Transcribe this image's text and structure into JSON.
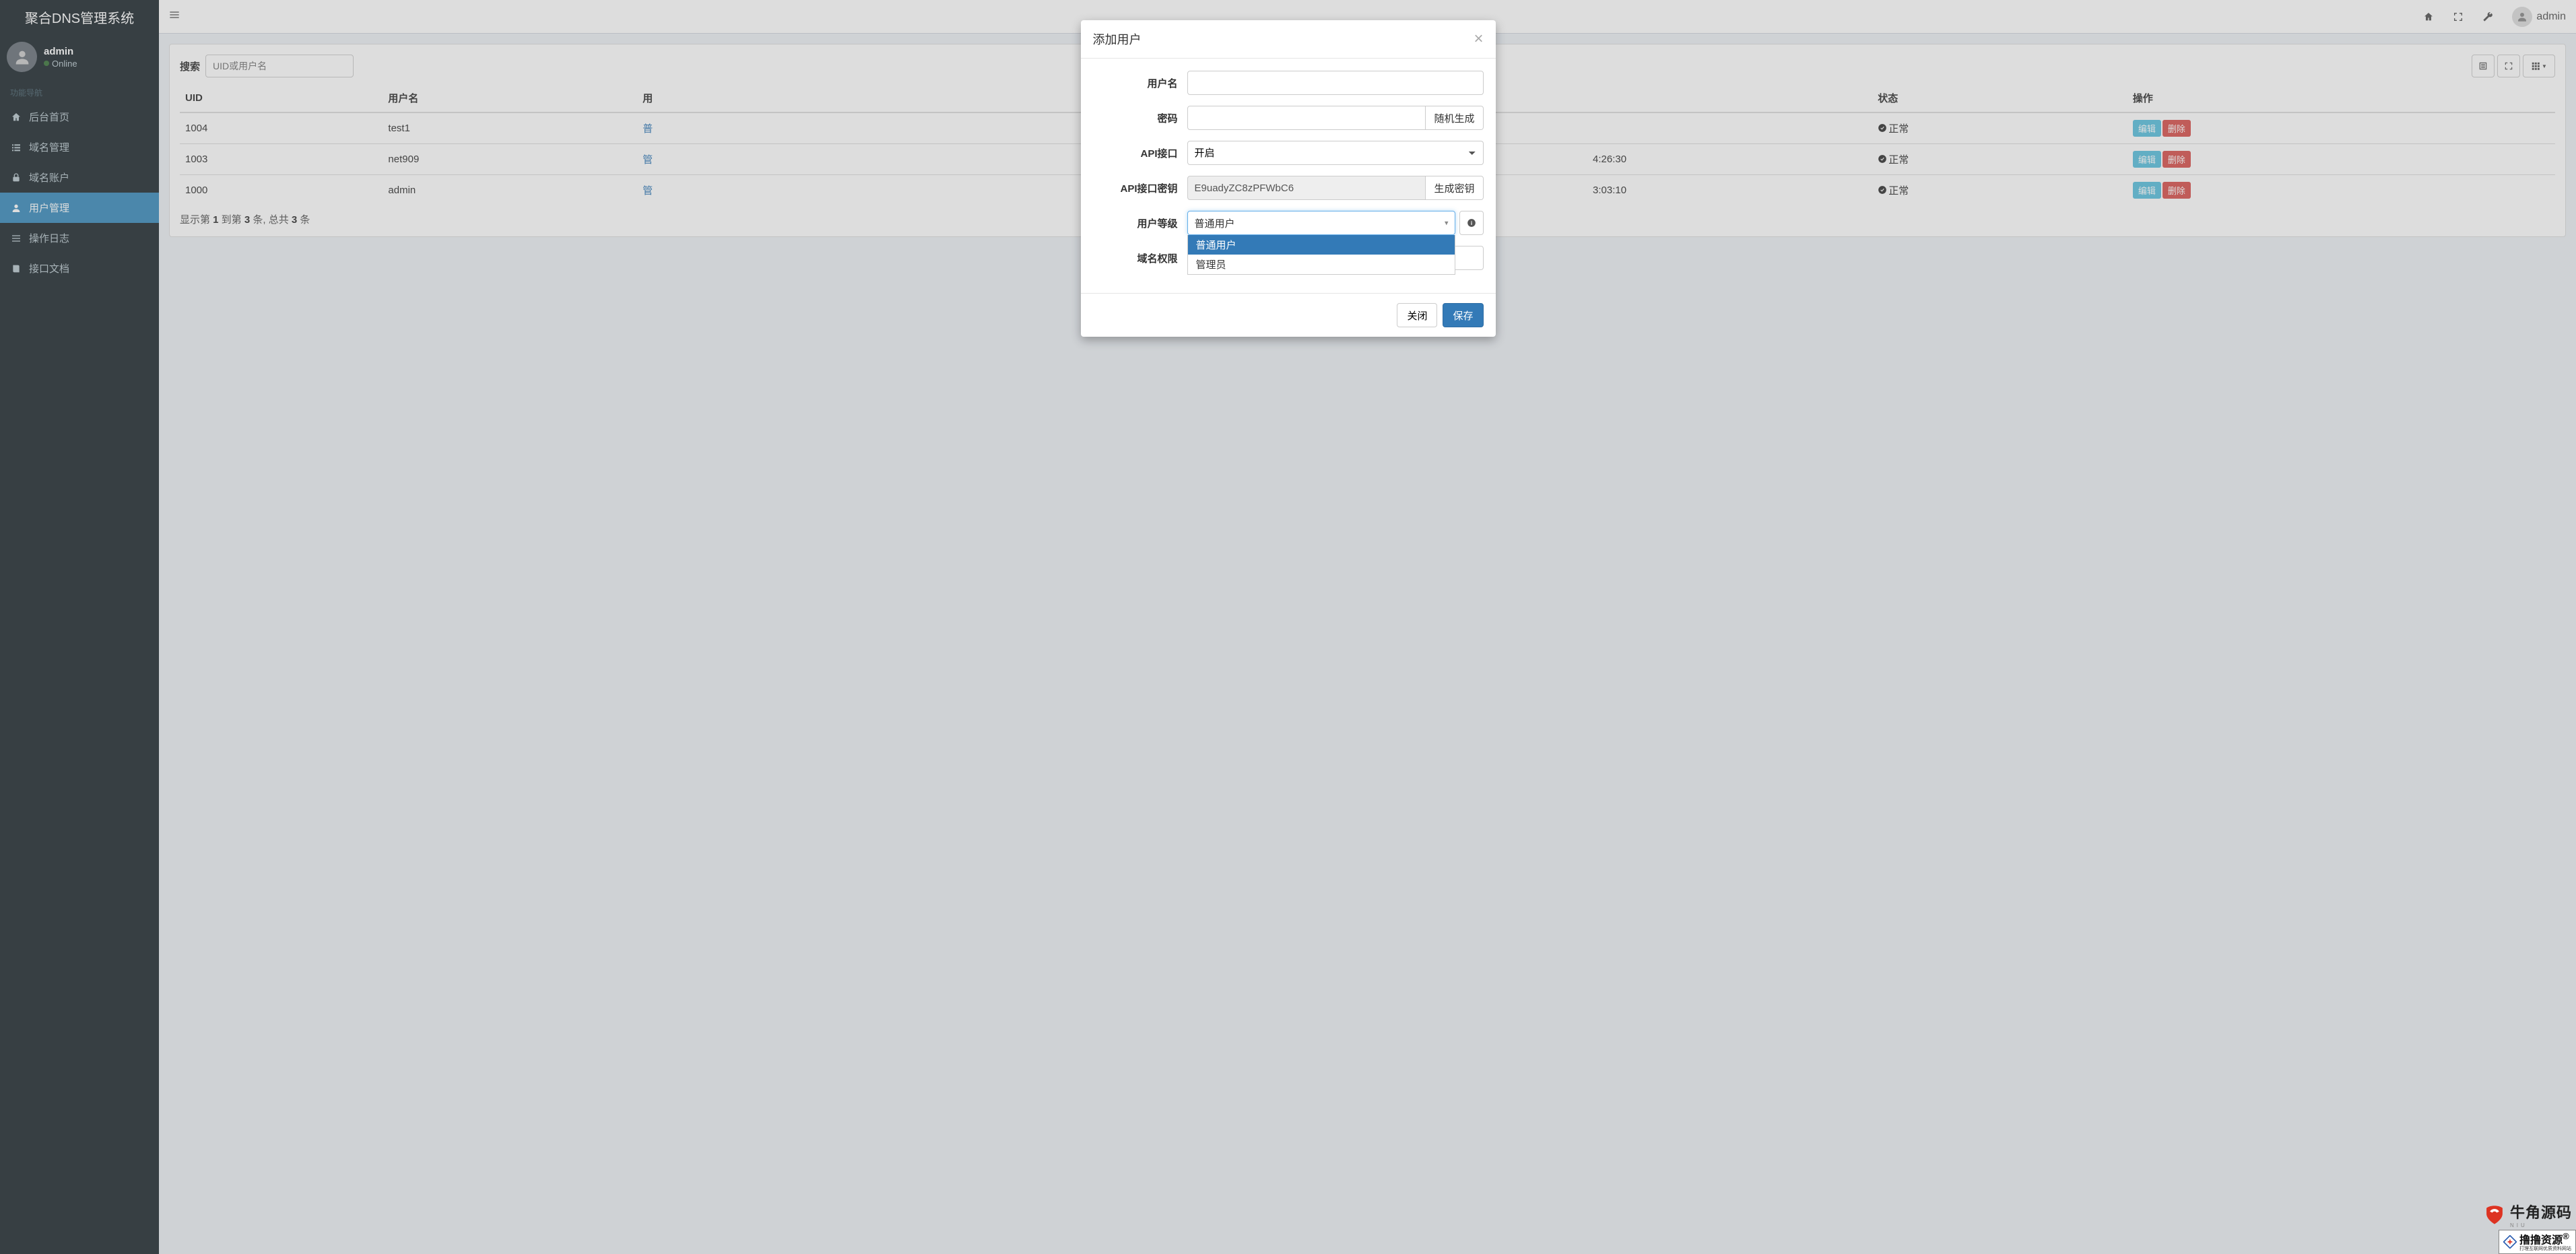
{
  "app": {
    "title": "聚合DNS管理系统"
  },
  "user": {
    "name": "admin",
    "status": "Online"
  },
  "sidebar": {
    "nav_header": "功能导航",
    "items": [
      {
        "label": "后台首页",
        "icon": "home"
      },
      {
        "label": "域名管理",
        "icon": "list"
      },
      {
        "label": "域名账户",
        "icon": "lock"
      },
      {
        "label": "用户管理",
        "icon": "user",
        "active": true
      },
      {
        "label": "操作日志",
        "icon": "bars"
      },
      {
        "label": "接口文档",
        "icon": "book"
      }
    ]
  },
  "topbar": {
    "username": "admin"
  },
  "toolbar": {
    "search_label": "搜索",
    "search_placeholder": "UID或用户名"
  },
  "table": {
    "headers": {
      "uid": "UID",
      "username": "用户名",
      "level_prefix": "用",
      "time_fragment_1": "4:26:30",
      "time_fragment_2": "3:03:10",
      "status": "状态",
      "actions": "操作"
    },
    "status_label": "正常",
    "actions": {
      "edit": "编辑",
      "delete": "删除"
    },
    "rows": [
      {
        "uid": "1004",
        "username": "test1",
        "level_partial": "普"
      },
      {
        "uid": "1003",
        "username": "net909",
        "level_partial": "管"
      },
      {
        "uid": "1000",
        "username": "admin",
        "level_partial": "管"
      }
    ],
    "pagination": {
      "prefix": "显示第 ",
      "from": "1",
      "mid1": " 到第 ",
      "to": "3",
      "mid2": " 条, 总共 ",
      "total": "3",
      "suffix": " 条"
    }
  },
  "modal": {
    "title": "添加用户",
    "fields": {
      "username": {
        "label": "用户名",
        "value": ""
      },
      "password": {
        "label": "密码",
        "value": "",
        "gen_label": "随机生成"
      },
      "api": {
        "label": "API接口",
        "value": "开启"
      },
      "api_key": {
        "label": "API接口密钥",
        "value": "E9uadyZC8zPFWbC6",
        "gen_label": "生成密钥"
      },
      "level": {
        "label": "用户等级",
        "value": "普通用户",
        "options": [
          "普通用户",
          "管理员"
        ]
      },
      "domain_perm": {
        "label": "域名权限",
        "value": ""
      }
    },
    "footer": {
      "close": "关闭",
      "save": "保存"
    }
  },
  "watermarks": {
    "wm1": {
      "text_cn": "牛角源码",
      "text_en": "NIU"
    },
    "wm2": {
      "main": "撸撸资源",
      "sub": "打理互联网优质资料网站",
      "reg": "®"
    }
  }
}
